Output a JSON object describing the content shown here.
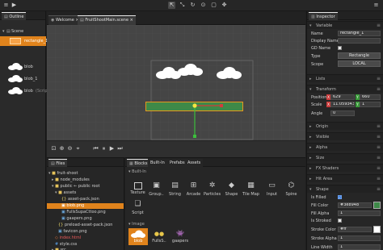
{
  "outline": {
    "tab": "Outline",
    "scene_label": "Scene",
    "items": [
      {
        "name": "rectangle_1",
        "selected": true
      },
      {
        "name": "blob"
      },
      {
        "name": "blob_1"
      },
      {
        "name": "blob",
        "suffix": "(Scrip"
      }
    ]
  },
  "editor": {
    "tabs": [
      "Welcome",
      "FruitShootMain.scene"
    ],
    "close_glyph": "×"
  },
  "files": {
    "tab": "Files",
    "tree": [
      {
        "label": "fruit-shoot",
        "kind": "folder"
      },
      {
        "label": "node_modules",
        "kind": "folder"
      },
      {
        "label": "public ← public root",
        "kind": "folder"
      },
      {
        "label": "assets",
        "kind": "folder"
      },
      {
        "label": "asset-pack.json",
        "kind": "json"
      },
      {
        "label": "blob.png",
        "kind": "png",
        "selected": true
      },
      {
        "label": "FullsSupaCttoo.png",
        "kind": "png"
      },
      {
        "label": "gaapers.png",
        "kind": "png"
      },
      {
        "label": "preload-asset-pack.json",
        "kind": "json"
      },
      {
        "label": "favicon.png",
        "kind": "png"
      },
      {
        "label": "index.html",
        "kind": "html"
      },
      {
        "label": "style.css",
        "kind": "css"
      },
      {
        "label": "src",
        "kind": "folder"
      },
      {
        "label": "types",
        "kind": "folder"
      }
    ]
  },
  "blocks": {
    "tabs": [
      "Blocks",
      "Built-In",
      "Prefabs",
      "Assets"
    ],
    "section_builtin": "Built-In",
    "builtin": [
      "Texture",
      "Group..",
      "String",
      "Arcade",
      "Particles",
      "Shape",
      "Tile Map",
      "Input",
      "Spine",
      "Script"
    ],
    "section_image": "Image",
    "images": [
      "blob",
      "FullsS..",
      "gaapers"
    ]
  },
  "inspector": {
    "tab": "Inspector",
    "variable": {
      "title": "Variable",
      "name_label": "Name",
      "name_value": "rectangle_1",
      "display_name_label": "Display Name",
      "gd_name_label": "GD Name",
      "type_label": "Type",
      "type_value": "Rectangle",
      "scope_label": "Scope",
      "scope_value": "LOCAL"
    },
    "lists_title": "Lists",
    "transform": {
      "title": "Transform",
      "position_label": "Position",
      "pos_x_label": "X",
      "pos_x": "629",
      "pos_y_label": "Y",
      "pos_y": "660",
      "scale_label": "Scale",
      "scale_x_label": "X",
      "scale_x": "11.0593439",
      "scale_y_label": "Y",
      "scale_y": "1",
      "angle_label": "Angle",
      "angle": "0"
    },
    "collapsed": [
      "Origin",
      "Visible",
      "Alpha",
      "Size",
      "FX Shaders",
      "Hit Area"
    ],
    "shape": {
      "title": "Shape",
      "is_filled_label": "Is Filled",
      "fill_color_label": "Fill Color",
      "fill_color": "#3e8948",
      "fill_alpha_label": "Fill Alpha",
      "fill_alpha": "1",
      "is_stroked_label": "Is Stroked",
      "stroke_color_label": "Stroke Color",
      "stroke_color": "#ff",
      "stroke_alpha_label": "Stroke Alpha",
      "stroke_alpha": "1",
      "line_width_label": "Line Width",
      "line_width": "1"
    }
  },
  "colors": {
    "accent": "#f28a1a",
    "selection": "#e8961c",
    "rect_fill": "#3e8948",
    "axis_red": "#d23c3c",
    "axis_green": "#3cbf3c"
  }
}
